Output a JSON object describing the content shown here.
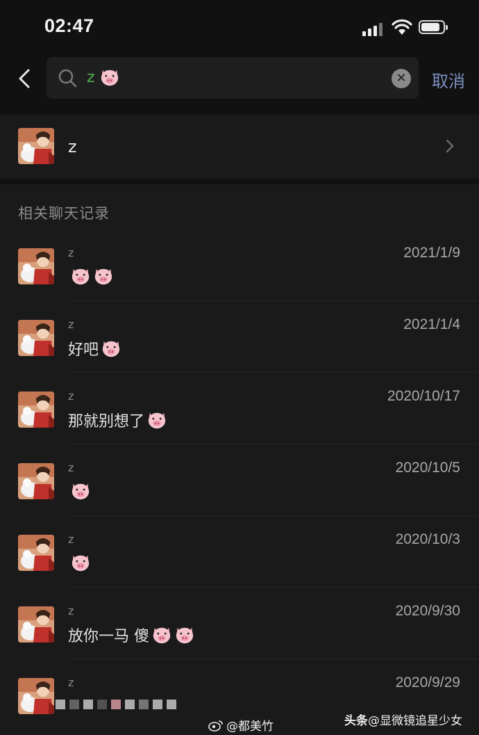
{
  "status": {
    "time": "02:47"
  },
  "search": {
    "query": "z",
    "cancel_label": "取消"
  },
  "contact": {
    "name": "z"
  },
  "section": {
    "title": "相关聊天记录"
  },
  "messages": [
    {
      "sender": "z",
      "date": "2021/1/9",
      "text": "",
      "pigs": 2
    },
    {
      "sender": "z",
      "date": "2021/1/4",
      "text": "好吧",
      "pigs": 1
    },
    {
      "sender": "z",
      "date": "2020/10/17",
      "text": "那就别想了",
      "pigs": 1
    },
    {
      "sender": "z",
      "date": "2020/10/5",
      "text": "",
      "pigs": 1
    },
    {
      "sender": "z",
      "date": "2020/10/3",
      "text": "",
      "pigs": 1
    },
    {
      "sender": "z",
      "date": "2020/9/30",
      "text": "放你一马 傻",
      "pigs": 2
    },
    {
      "sender": "z",
      "date": "2020/9/29",
      "text": "",
      "pigs": 0
    }
  ],
  "watermarks": {
    "weibo": "@都美竹",
    "toutiao_brand": "头条",
    "toutiao_handle": "@显微镜追星少女"
  },
  "colors": {
    "background": "#111111",
    "panel": "#1a1a1a",
    "accent_cancel": "#7d8fc0",
    "query": "#4caf50"
  }
}
